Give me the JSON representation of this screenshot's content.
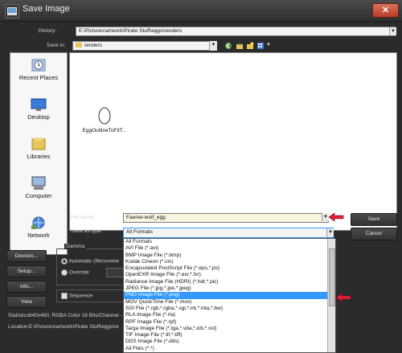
{
  "window": {
    "title": "Save Image",
    "close_label": "✕"
  },
  "history": {
    "label": "History:",
    "value": "E:\\Pictures\\artwork\\Pirate Stuff\\eggs\\renders"
  },
  "save_in": {
    "label": "Save in:",
    "value": "renders"
  },
  "places": [
    {
      "label": "Recent Places",
      "icon": "recent-places-icon"
    },
    {
      "label": "Desktop",
      "icon": "desktop-icon"
    },
    {
      "label": "Libraries",
      "icon": "libraries-icon"
    },
    {
      "label": "Computer",
      "icon": "computer-icon"
    },
    {
      "label": "Network",
      "icon": "network-icon"
    }
  ],
  "files": [
    {
      "name": "EggOutlineToFitT..."
    }
  ],
  "file_name": {
    "label": "File name:",
    "value": "Faeree-wolf_egg"
  },
  "save_as_type": {
    "label": "Save as type:",
    "value": "All Formats"
  },
  "buttons": {
    "save": "Save",
    "cancel": "Cancel",
    "devices": "Devices...",
    "setup": "Setup...",
    "info": "Info...",
    "view": "View"
  },
  "gamma": {
    "label": "Gamma",
    "automatic": "Automatic (Recomme",
    "override": "Override"
  },
  "sequence": {
    "label": "Sequence"
  },
  "statistics": {
    "label": "Statistics:",
    "value": "640x480, RGBA Color 16 Bits/Channel -"
  },
  "location": {
    "label": "Location:",
    "value": "E:\\Pictures\\artwork\\Pirate Stuff\\eggs\\re"
  },
  "type_options": [
    "All Formats",
    "AVI File (*.avi)",
    "BMP Image File (*.bmp)",
    "Kodak Cineon (*.cin)",
    "Encapsulated PostScript File (*.eps,*.ps)",
    "OpenEXR Image File (*.exr,*.fxr)",
    "Radiance Image File (HDRI) (*.hdr,*.pic)",
    "JPEG File (*.jpg,*.jpe,*.jpeg)",
    "PNG Image File (*.png)",
    "MOV QuickTime File (*.mov)",
    "SGI File (*.rgb,*.rgba,*.sgi,*.int,*.inta,*.bw)",
    "RLA Image File (*.rla)",
    "RPF Image File (*.rpf)",
    "Targa Image File (*.tga,*.vda,*.icb,*.vst)",
    "TIF Image File (*.tif,*.tiff)",
    "DDS Image File (*.dds)",
    "All Files (*.*)"
  ],
  "selected_type_index": 8,
  "colors": {
    "accent": "#3399ff",
    "annotation_arrow": "#e0203a"
  }
}
